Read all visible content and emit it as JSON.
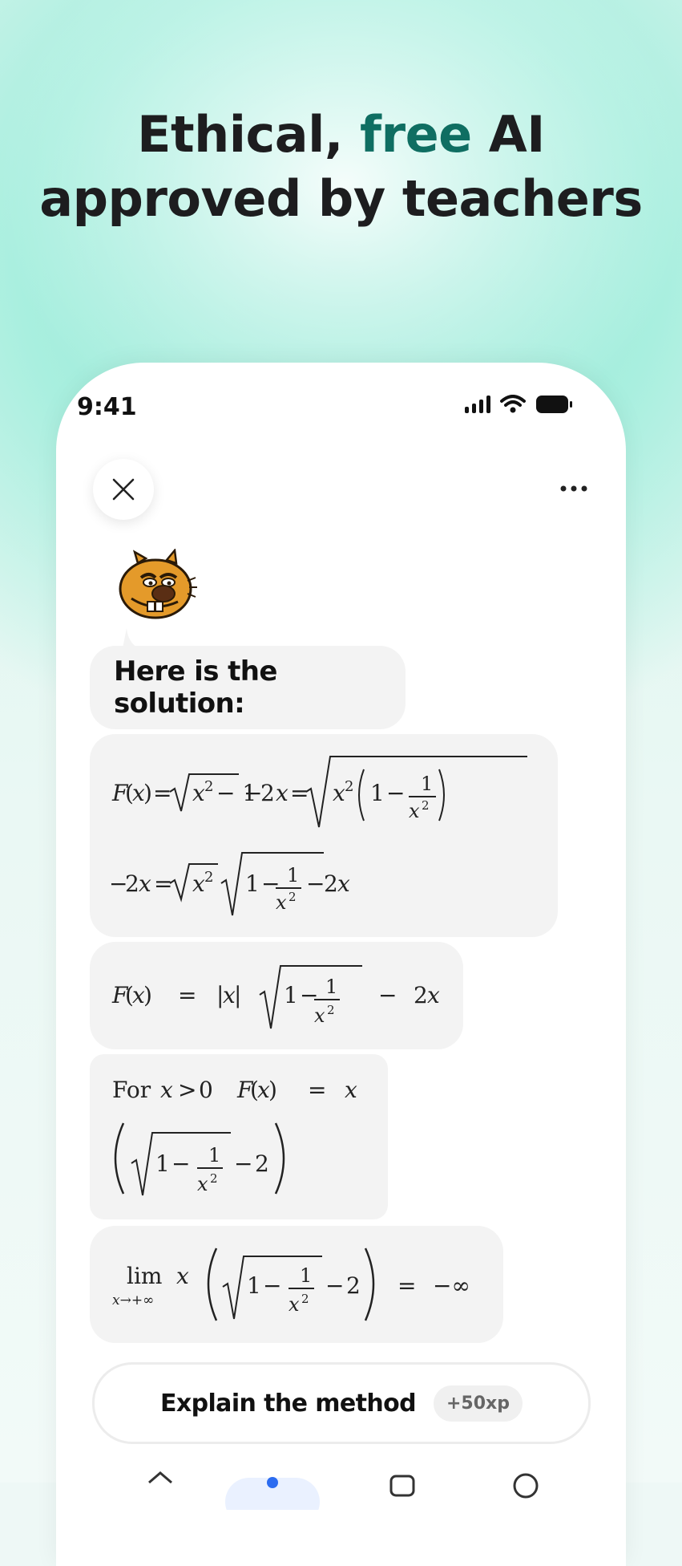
{
  "headline": {
    "part1": "Ethical,",
    "accent": "free",
    "part2": "AI",
    "line2": "approved by teachers"
  },
  "status": {
    "time": "9:41"
  },
  "chat": {
    "title": "Here is the solution:",
    "explain_label": "Explain the method",
    "xp_badge": "+50xp"
  },
  "colors": {
    "accent": "#0f6e62",
    "glow": "#8ee8d4"
  },
  "icons": [
    "close-icon",
    "more-icon",
    "signal-icon",
    "wifi-icon",
    "battery-icon",
    "mascot-beaver"
  ]
}
